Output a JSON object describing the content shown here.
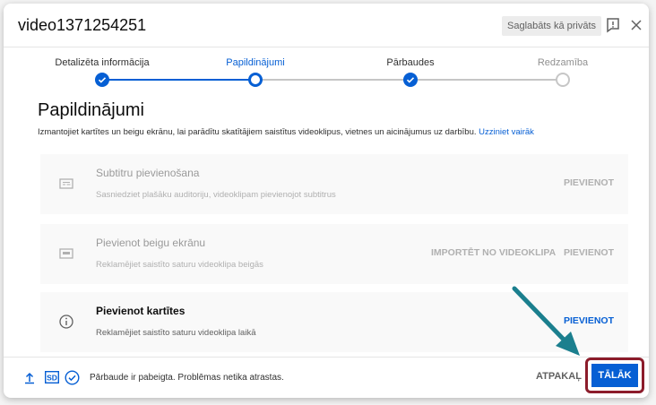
{
  "header": {
    "title": "video1371254251",
    "saved_status": "Saglabāts kā privāts",
    "icons": [
      "feedback-icon",
      "close-icon"
    ]
  },
  "stepper": {
    "steps": [
      {
        "label": "Detalizēta informācija",
        "state": "done"
      },
      {
        "label": "Papildinājumi",
        "state": "current"
      },
      {
        "label": "Pārbaudes",
        "state": "done"
      },
      {
        "label": "Redzamība",
        "state": "pending"
      }
    ]
  },
  "main": {
    "title": "Papildinājumi",
    "description": "Izmantojiet kartītes un beigu ekrānu, lai parādītu skatītājiem saistītus videoklipus, vietnes un aicinājumus uz darbību.",
    "learn_more": "Uzziniet vairāk",
    "cards": [
      {
        "title": "Subtitru pievienošana",
        "subtitle": "Sasniedziet plašāku auditoriju, videoklipam pievienojot subtitrus",
        "secondary_action": "",
        "action": "PIEVIENOT",
        "enabled": false,
        "icon": "subtitles-icon"
      },
      {
        "title": "Pievienot beigu ekrānu",
        "subtitle": "Reklamējiet saistīto saturu videoklipa beigās",
        "secondary_action": "IMPORTĒT NO VIDEOKLIPA",
        "action": "PIEVIENOT",
        "enabled": false,
        "icon": "end-screen-icon"
      },
      {
        "title": "Pievienot kartītes",
        "subtitle": "Reklamējiet saistīto saturu videoklipa laikā",
        "secondary_action": "",
        "action": "PIEVIENOT",
        "enabled": true,
        "icon": "info-icon"
      }
    ]
  },
  "footer": {
    "status_text": "Pārbaude ir pabeigta. Problēmas netika atrastas.",
    "sd_badge": "SD",
    "back_label": "ATPAKAĻ",
    "next_label": "TĀLĀK"
  },
  "colors": {
    "accent": "#065fd4",
    "highlight_border": "#8c1c2b",
    "annotation_arrow": "#1b7f8e"
  }
}
